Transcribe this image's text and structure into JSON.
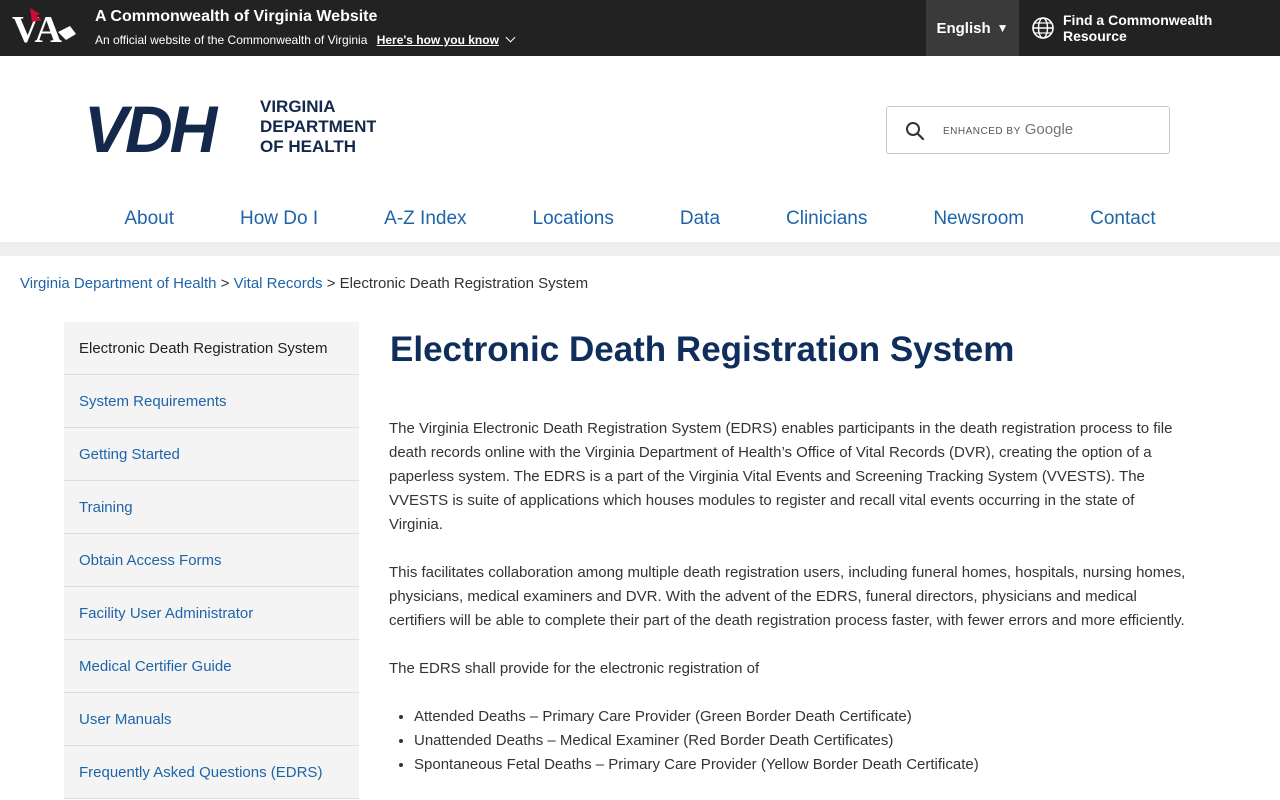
{
  "commonwealth_bar": {
    "logo_text": "VA",
    "title": "A Commonwealth of Virginia Website",
    "subtitle": "An official website of the Commonwealth of Virginia",
    "how_link": "Here's how you know",
    "language": "English",
    "find_resource": "Find a Commonwealth Resource"
  },
  "header": {
    "logo_mark": "VDH",
    "logo_line1": "VIRGINIA",
    "logo_line2": "DEPARTMENT",
    "logo_line3": "OF HEALTH",
    "search_enhanced": "ENHANCED BY",
    "search_google": "Google"
  },
  "nav": [
    "About",
    "How Do I",
    "A-Z Index",
    "Locations",
    "Data",
    "Clinicians",
    "Newsroom",
    "Contact"
  ],
  "breadcrumb": {
    "home": "Virginia Department of Health",
    "section": "Vital Records",
    "current": "Electronic Death Registration System",
    "separator": ">"
  },
  "sidebar": {
    "items": [
      "Electronic Death Registration System",
      "System Requirements",
      "Getting Started",
      "Training",
      "Obtain Access Forms",
      "Facility User Administrator",
      "Medical Certifier Guide",
      "User Manuals",
      "Frequently Asked Questions (EDRS)"
    ]
  },
  "main": {
    "title": "Electronic Death Registration System",
    "paragraphs": [
      "The Virginia Electronic Death Registration System (EDRS) enables participants in the death registration process to file death records online with the Virginia Department of Health’s Office of Vital Records (DVR), creating the option of a paperless system. The EDRS is a part of the Virginia Vital Events and Screening Tracking System (VVESTS). The VVESTS is suite of applications which houses modules to register and recall vital events occurring in the state of Virginia.",
      "This facilitates collaboration among multiple death registration users, including funeral homes, hospitals, nursing homes, physicians, medical examiners and DVR. With the advent of the EDRS, funeral directors, physicians and medical certifiers will be able to complete their part of the death registration process faster, with fewer errors and more efficiently.",
      "The EDRS shall provide for the electronic registration of"
    ],
    "list": [
      "Attended Deaths – Primary Care Provider (Green Border Death Certificate)",
      "Unattended Deaths – Medical Examiner (Red Border Death Certificates)",
      "Spontaneous Fetal Deaths – Primary Care Provider (Yellow Border Death Certificate)"
    ]
  },
  "colors": {
    "top_bar": "#222222",
    "link_blue": "#1f64a8",
    "title_navy": "#102e5b",
    "logo_navy": "#14284b",
    "cardinal_red": "#c8102e"
  }
}
